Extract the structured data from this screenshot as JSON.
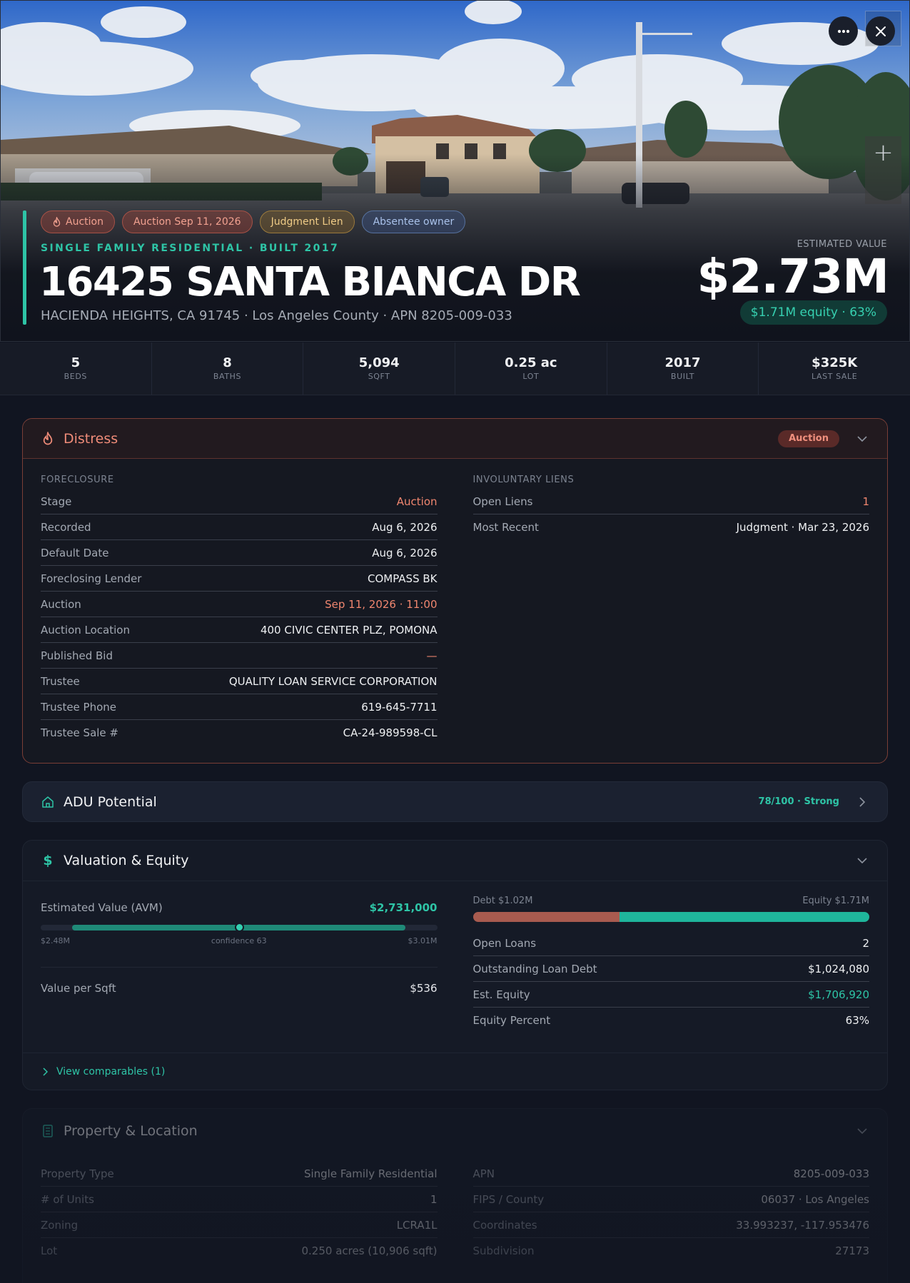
{
  "hero": {
    "tags": [
      {
        "label": "Auction"
      },
      {
        "label": "Auction Sep 11, 2026"
      },
      {
        "label": "Judgment Lien"
      },
      {
        "label": "Absentee owner"
      }
    ],
    "subtitle": "SINGLE FAMILY RESIDENTIAL · BUILT 2017",
    "address": "16425 SANTA BIANCA DR",
    "location": "HACIENDA HEIGHTS, CA 91745 · Los Angeles County · APN 8205-009-033",
    "estimated_label": "ESTIMATED VALUE",
    "estimated_value": "$2.73M",
    "equity_pill": "$1.71M equity · 63%",
    "zoom_in": "+"
  },
  "stats": [
    {
      "value": "5",
      "label": "BEDS"
    },
    {
      "value": "8",
      "label": "BATHS"
    },
    {
      "value": "5,094",
      "label": "SQFT"
    },
    {
      "value": "0.25 ac",
      "label": "LOT"
    },
    {
      "value": "2017",
      "label": "BUILT"
    },
    {
      "value": "$325K",
      "label": "LAST SALE"
    }
  ],
  "distress": {
    "title": "Distress",
    "badge": "Auction",
    "foreclosure_label": "FORECLOSURE",
    "foreclosure": [
      {
        "k": "Stage",
        "v": "Auction"
      },
      {
        "k": "Recorded",
        "v": "Aug 6, 2026"
      },
      {
        "k": "Default Date",
        "v": "Aug 6, 2026"
      },
      {
        "k": "Foreclosing Lender",
        "v": "COMPASS BK"
      },
      {
        "k": "Auction",
        "v": "Sep 11, 2026 · 11:00"
      },
      {
        "k": "Auction Location",
        "v": "400 CIVIC CENTER PLZ, POMONA"
      },
      {
        "k": "Published Bid",
        "v": "—"
      },
      {
        "k": "Trustee",
        "v": "QUALITY LOAN SERVICE CORPORATION"
      },
      {
        "k": "Trustee Phone",
        "v": "619-645-7711"
      },
      {
        "k": "Trustee Sale #",
        "v": "CA-24-989598-CL"
      }
    ],
    "liens_label": "INVOLUNTARY LIENS",
    "liens": [
      {
        "k": "Open Liens",
        "v": "1"
      },
      {
        "k": "Most Recent",
        "v": "Judgment · Mar 23, 2026"
      }
    ]
  },
  "adu": {
    "title": "ADU Potential",
    "score": "78/100 · Strong"
  },
  "valuation": {
    "title": "Valuation & Equity",
    "avm_label": "Estimated Value (AVM)",
    "avm_value": "$2,731,000",
    "range_low": "$2.48M",
    "range_high": "$3.01M",
    "confidence_label": "confidence 63",
    "confidence_range_fraction": [
      0.08,
      0.92
    ],
    "avm_position_fraction": 0.5,
    "value_per_sqft_label": "Value per Sqft",
    "value_per_sqft": "$536",
    "debt_label": "Debt $1.02M",
    "equity_label": "Equity $1.71M",
    "debt_fraction": 0.37,
    "rows": [
      {
        "k": "Open Loans",
        "v": "2"
      },
      {
        "k": "Outstanding Loan Debt",
        "v": "$1,024,080"
      },
      {
        "k": "Est. Equity",
        "v": "$1,706,920"
      },
      {
        "k": "Equity Percent",
        "v": "63%"
      }
    ],
    "comparables": "View comparables (1)"
  },
  "property": {
    "title": "Property & Location",
    "left": [
      {
        "k": "Property Type",
        "v": "Single Family Residential"
      },
      {
        "k": "# of Units",
        "v": "1"
      },
      {
        "k": "Zoning",
        "v": "LCRA1L"
      },
      {
        "k": "Lot",
        "v": "0.250 acres (10,906 sqft)"
      }
    ],
    "right": [
      {
        "k": "APN",
        "v": "8205-009-033"
      },
      {
        "k": "FIPS / County",
        "v": "06037 · Los Angeles"
      },
      {
        "k": "Coordinates",
        "v": "33.993237, -117.953476"
      },
      {
        "k": "Subdivision",
        "v": "27173"
      }
    ]
  },
  "colors": {
    "accent": "#2ec4a6",
    "distress": "#f08c79",
    "debt": "#a85b4f",
    "equity": "#1fb59b",
    "background": "#111521"
  }
}
